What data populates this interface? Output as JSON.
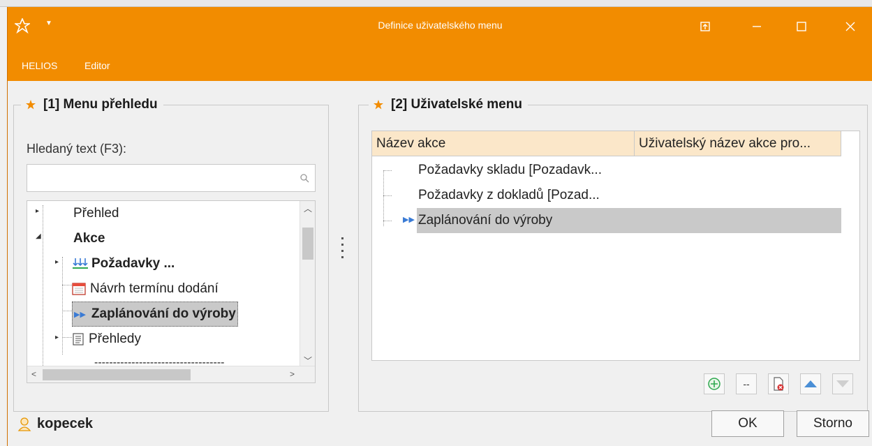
{
  "window": {
    "title": "Definice uživatelského menu"
  },
  "menubar": {
    "items": [
      {
        "label": "HELIOS"
      },
      {
        "label": "Editor"
      }
    ]
  },
  "left_panel": {
    "title": "[1] Menu přehledu",
    "search_label": "Hledaný text (F3):",
    "search_value": "",
    "tree": [
      {
        "label": "Přehled"
      },
      {
        "label": "Akce"
      },
      {
        "label": "Požadavky ..."
      },
      {
        "label": "Návrh termínu dodání"
      },
      {
        "label": "Zaplánování do výroby"
      },
      {
        "label": "Přehledy"
      },
      {
        "label": "-----------------------------------"
      }
    ]
  },
  "right_panel": {
    "title": "[2] Uživatelské menu",
    "columns": [
      "Název akce",
      "Uživatelský název akce pro..."
    ],
    "rows": [
      {
        "label": "Požadavky skladu [Pozadavk..."
      },
      {
        "label": "Požadavky z dokladů [Pozad..."
      },
      {
        "label": "Zaplánování do výroby"
      }
    ],
    "toolbar": {
      "separator_label": "--"
    }
  },
  "status": {
    "user": "kopecek"
  },
  "buttons": {
    "ok": "OK",
    "cancel": "Storno"
  },
  "colors": {
    "accent": "#f28c00",
    "header": "#fbe7c9",
    "selection": "#c9c9c9"
  }
}
